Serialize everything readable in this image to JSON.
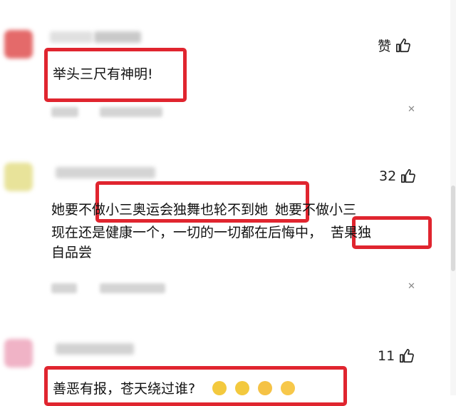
{
  "comments": [
    {
      "likes": "赞",
      "text": "举头三尺有神明!"
    },
    {
      "likes": "32",
      "line1_a": "她要不",
      "line1_b": "做小三奥运会独舞也轮不到她",
      "line1_c": "她要不做小三",
      "line2_a": "现在还是健康一个，一切的一切都在后悔中，",
      "line2_b": "苦果独",
      "line3": "自品尝"
    },
    {
      "likes": "11",
      "text": "善恶有报，苍天绕过谁?"
    }
  ],
  "icons": {
    "like": "thumbs-up-icon",
    "close": "close-icon"
  },
  "colors": {
    "highlight": "#e0252f",
    "text": "#111111"
  }
}
